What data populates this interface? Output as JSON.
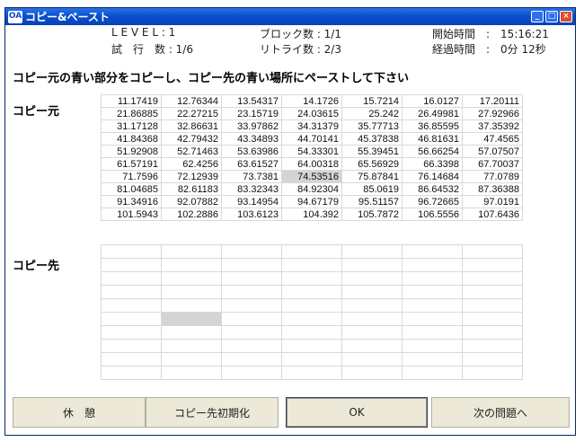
{
  "window": {
    "title": "コピー&ペースト",
    "icon_text": "OA",
    "controls": [
      "_",
      "□",
      "×"
    ]
  },
  "info": {
    "level": "L E V E L : 1",
    "trial": "試　行　数 : 1/6",
    "blocks": "ブロック数 : 1/1",
    "retry": "リトライ数 : 2/3",
    "start_time": "開始時間　:　15:16:21",
    "elapsed": "経過時間　:　0分 12秒"
  },
  "instruction": "コピー元の青い部分をコピーし、コピー先の青い場所にペーストして下さい",
  "source_label": "コピー元",
  "dest_label": "コピー先",
  "source_table": [
    [
      "11.17419",
      "12.76344",
      "13.54317",
      "14.1726",
      "15.7214",
      "16.0127",
      "17.20111"
    ],
    [
      "21.86885",
      "22.27215",
      "23.15719",
      "24.03615",
      "25.242",
      "26.49981",
      "27.92966"
    ],
    [
      "31.17128",
      "32.86631",
      "33.97862",
      "34.31379",
      "35.77713",
      "36.85595",
      "37.35392"
    ],
    [
      "41.84368",
      "42.79432",
      "43.34893",
      "44.70141",
      "45.37838",
      "46.81631",
      "47.4565"
    ],
    [
      "51.92908",
      "52.71463",
      "53.63986",
      "54.33301",
      "55.39451",
      "56.66254",
      "57.07507"
    ],
    [
      "61.57191",
      "62.4256",
      "63.61527",
      "64.00318",
      "65.56929",
      "66.3398",
      "67.70037"
    ],
    [
      "71.7596",
      "72.12939",
      "73.7381",
      "74.53516",
      "75.87841",
      "76.14684",
      "77.0789"
    ],
    [
      "81.04685",
      "82.61183",
      "83.32343",
      "84.92304",
      "85.0619",
      "86.64532",
      "87.36388"
    ],
    [
      "91.34916",
      "92.07882",
      "93.14954",
      "94.67179",
      "95.51157",
      "96.72665",
      "97.0191"
    ],
    [
      "101.5943",
      "102.2886",
      "103.6123",
      "104.392",
      "105.7872",
      "106.5556",
      "107.6436"
    ]
  ],
  "source_highlight": {
    "row": 6,
    "col": 3
  },
  "dest_rows": 10,
  "dest_cols": 7,
  "dest_highlight": {
    "row": 5,
    "col": 1
  },
  "buttons": {
    "rest": "休　憩",
    "reset": "コピー先初期化",
    "ok": "OK",
    "next": "次の問題へ"
  },
  "colors": {
    "titlebar": "#0a4fcf",
    "highlight": "#d4d4d4",
    "face": "#ece9d8"
  }
}
